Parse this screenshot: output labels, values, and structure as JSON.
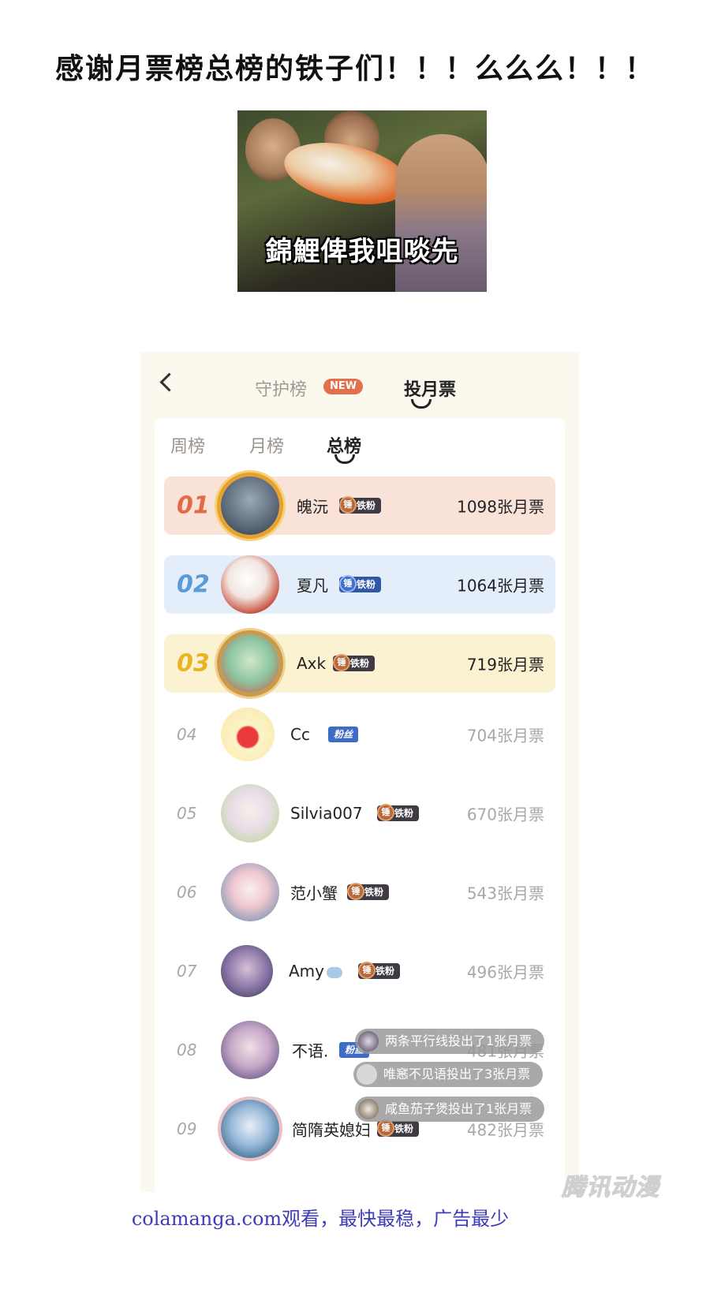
{
  "headline": "感谢月票榜总榜的铁子们！！！么么么！！！",
  "meme_caption": "錦鯉俾我咀啖先",
  "top_tabs": {
    "guard": "守护榜",
    "new_badge": "NEW",
    "vote": "投月票"
  },
  "sub_tabs": [
    "周榜",
    "月榜",
    "总榜"
  ],
  "rankings": [
    {
      "rank": "01",
      "name": "魄沅",
      "badge": "铁粉",
      "badge_icon": "锤",
      "votes": "1098张月票"
    },
    {
      "rank": "02",
      "name": "夏凡",
      "badge": "铁粉",
      "badge_icon": "锤",
      "votes": "1064张月票"
    },
    {
      "rank": "03",
      "name": "Axk",
      "badge": "铁粉",
      "badge_icon": "锤",
      "votes": "719张月票"
    },
    {
      "rank": "04",
      "name": "Cc",
      "badge": "粉丝",
      "votes": "704张月票"
    },
    {
      "rank": "05",
      "name": "Silvia007",
      "badge": "铁粉",
      "badge_icon": "锤",
      "votes": "670张月票"
    },
    {
      "rank": "06",
      "name": "范小蟹",
      "badge": "铁粉",
      "badge_icon": "锤",
      "votes": "543张月票"
    },
    {
      "rank": "07",
      "name": "Amy",
      "badge": "铁粉",
      "badge_icon": "锤",
      "votes": "496张月票"
    },
    {
      "rank": "08",
      "name": "不语.",
      "badge": "粉丝",
      "votes": "481张月票"
    },
    {
      "rank": "09",
      "name": "简隋英媳妇",
      "badge": "铁粉",
      "badge_icon": "锤",
      "votes": "482张月票"
    }
  ],
  "toasts": [
    "两条平行线投出了1张月票",
    "唯窸不见语投出了3张月票",
    "咸鱼茄子煲投出了1张月票"
  ],
  "watermark": "腾讯动漫",
  "footer": "colamanga.com观看，最快最稳，广告最少",
  "colors": {
    "row1": "#f9e3d9",
    "row2": "#e4eefb",
    "row3": "#fbf2d2",
    "rank1": "#e26b4a",
    "rank2": "#5a9ad8",
    "rank3": "#e8b422"
  }
}
